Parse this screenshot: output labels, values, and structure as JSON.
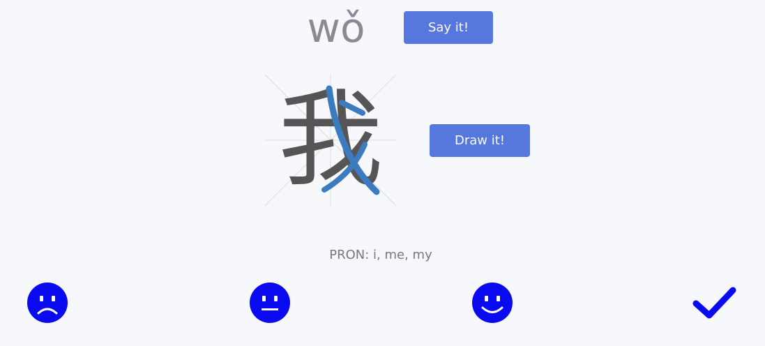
{
  "card": {
    "pinyin": "wǒ",
    "character": "我",
    "meaning": "PRON: i, me, my"
  },
  "buttons": {
    "say_label": "Say it!",
    "draw_label": "Draw it!"
  },
  "ratings": [
    {
      "name": "sad-face-icon"
    },
    {
      "name": "neutral-face-icon"
    },
    {
      "name": "happy-face-icon"
    },
    {
      "name": "checkmark-icon"
    }
  ],
  "colors": {
    "background": "#f7f8fc",
    "button": "#5577de",
    "rating_icon": "#0a0af0",
    "character_gray": "#555555",
    "character_blue": "#3b7bbf",
    "pinyin": "#8a8a94"
  }
}
